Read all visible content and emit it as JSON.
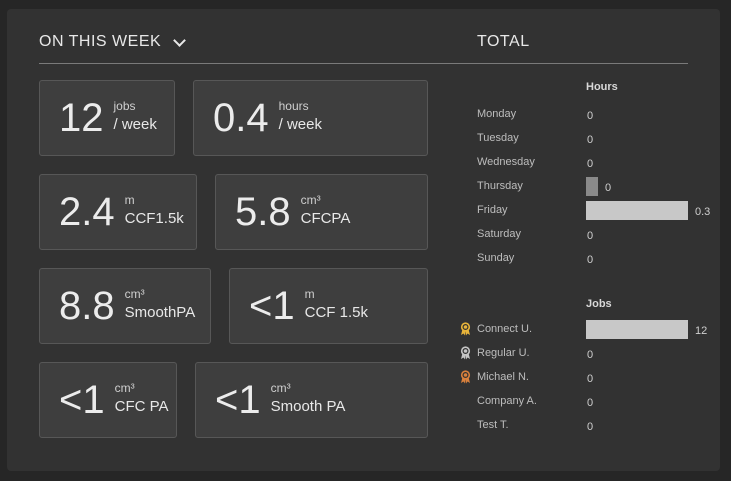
{
  "header": {
    "period_label": "ON THIS WEEK",
    "total_label": "TOTAL"
  },
  "cards": [
    {
      "value": "12",
      "unit": "jobs",
      "label": "/ week"
    },
    {
      "value": "0.4",
      "unit": "hours",
      "label": "/ week"
    },
    {
      "value": "2.4",
      "unit": "m",
      "label": "CCF1.5k"
    },
    {
      "value": "5.8",
      "unit": "cm³",
      "label": "CFCPA"
    },
    {
      "value": "8.8",
      "unit": "cm³",
      "label": "SmoothPA"
    },
    {
      "value": "<1",
      "unit": "m",
      "label": "CCF 1.5k"
    },
    {
      "value": "<1",
      "unit": "cm³",
      "label": "CFC PA"
    },
    {
      "value": "<1",
      "unit": "cm³",
      "label": "Smooth PA"
    }
  ],
  "hours": {
    "title": "Hours",
    "rows": [
      {
        "label": "Monday",
        "value": "0",
        "level": 0
      },
      {
        "label": "Tuesday",
        "value": "0",
        "level": 0
      },
      {
        "label": "Wednesday",
        "value": "0",
        "level": 0
      },
      {
        "label": "Thursday",
        "value": "0",
        "level": 0.12
      },
      {
        "label": "Friday",
        "value": "0.3",
        "level": 1
      },
      {
        "label": "Saturday",
        "value": "0",
        "level": 0
      },
      {
        "label": "Sunday",
        "value": "0",
        "level": 0
      }
    ]
  },
  "jobs": {
    "title": "Jobs",
    "rows": [
      {
        "label": "Connect U.",
        "value": "12",
        "level": 1,
        "medal": "gold-medal-icon",
        "color": "#e8b43a"
      },
      {
        "label": "Regular U.",
        "value": "0",
        "level": 0,
        "medal": "silver-medal-icon",
        "color": "#c6c6c6"
      },
      {
        "label": "Michael N.",
        "value": "0",
        "level": 0,
        "medal": "bronze-medal-icon",
        "color": "#d9803c"
      },
      {
        "label": "Company A.",
        "value": "0",
        "level": 0
      },
      {
        "label": "Test T.",
        "value": "0",
        "level": 0
      }
    ]
  }
}
